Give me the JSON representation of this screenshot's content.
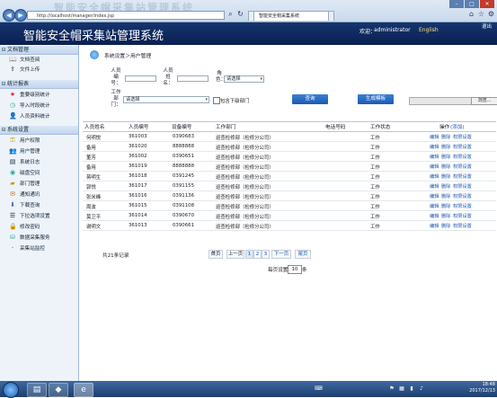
{
  "browser": {
    "address": "http://localhost/manager/index.jsp",
    "tabs": [
      "智能安全帽采集系统"
    ],
    "title_watermark": "智能安全帽采集站管理系统",
    "icons": [
      "back-icon",
      "forward-icon",
      "home-icon",
      "star-icon",
      "gear-icon"
    ]
  },
  "app": {
    "title": "智能安全帽采集站管理系统",
    "welcome": "欢迎：",
    "user": "administrator",
    "language": "English",
    "exit": "退出"
  },
  "sidebar": {
    "sections": [
      {
        "label": "文档管理",
        "items": [
          {
            "label": "文档查阅",
            "icon": "book-icon"
          },
          {
            "label": "文件上传",
            "icon": "upload-icon"
          }
        ]
      },
      {
        "label": "统计报表",
        "items": [
          {
            "label": "重要级别统计",
            "icon": "star-icon"
          },
          {
            "label": "导入时段统计",
            "icon": "clock-icon"
          },
          {
            "label": "人员资料统计",
            "icon": "person-icon"
          }
        ]
      },
      {
        "label": "系统设置",
        "items": [
          {
            "label": "用户权限",
            "icon": "key-icon"
          },
          {
            "label": "用户管理",
            "icon": "users-icon"
          },
          {
            "label": "系统日志",
            "icon": "log-icon"
          },
          {
            "label": "磁盘空间",
            "icon": "disk-icon"
          },
          {
            "label": "部门管理",
            "icon": "folder-icon"
          },
          {
            "label": "通知通讯",
            "icon": "mail-icon"
          },
          {
            "label": "下载查询",
            "icon": "download-icon"
          },
          {
            "label": "下拉选项设置",
            "icon": "list-icon"
          },
          {
            "label": "修改密码",
            "icon": "lock-icon"
          },
          {
            "label": "数据采集服务",
            "icon": "service-icon"
          },
          {
            "label": "采集站监控",
            "icon": "monitor-icon"
          }
        ]
      }
    ]
  },
  "breadcrumb": "系统设置＞用户管理",
  "filters": {
    "person_no_label": "人员编号：",
    "person_name_label": "人员姓名：",
    "role_label": "角色：",
    "role_value": "请选择",
    "dept_label": "工作部门：",
    "dept_value": "请选择",
    "include_sub_label": "包含下级部门",
    "query_button": "查询",
    "export_button": "生成模板",
    "browse_button": "浏览..."
  },
  "table": {
    "headers": [
      "人员姓名",
      "人员编号",
      "设备编号",
      "工作部门",
      "电话号码",
      "工作状态",
      "操作"
    ],
    "add_label": "(添加)",
    "actions": [
      "编辑",
      "删除",
      "权限设置"
    ],
    "rows": [
      {
        "name": "何明悦",
        "no": "361003",
        "device": "0390683",
        "dept": "巡查检修部（检修分公司）",
        "phone": "",
        "status": "工作"
      },
      {
        "name": "备用",
        "no": "361020",
        "device": "8888888",
        "dept": "巡查检修部（检修分公司）",
        "phone": "",
        "status": "工作"
      },
      {
        "name": "董芳",
        "no": "361002",
        "device": "0390651",
        "dept": "巡查检修部（检修分公司）",
        "phone": "",
        "status": "工作"
      },
      {
        "name": "备用",
        "no": "361019",
        "device": "8888888",
        "dept": "巡查检修部（检修分公司）",
        "phone": "",
        "status": "工作"
      },
      {
        "name": "蒋明生",
        "no": "361018",
        "device": "0391245",
        "dept": "巡查检修部（检修分公司）",
        "phone": "",
        "status": "工作"
      },
      {
        "name": "郭悦",
        "no": "361017",
        "device": "0391155",
        "dept": "巡查检修部（检修分公司）",
        "phone": "",
        "status": "工作"
      },
      {
        "name": "张米峰",
        "no": "361016",
        "device": "0391136",
        "dept": "巡查检修部（检修分公司）",
        "phone": "",
        "status": "工作"
      },
      {
        "name": "周波",
        "no": "361015",
        "device": "0391108",
        "dept": "巡查检修部（检修分公司）",
        "phone": "",
        "status": "工作"
      },
      {
        "name": "莫卫平",
        "no": "361014",
        "device": "0390670",
        "dept": "巡查检修部（检修分公司）",
        "phone": "",
        "status": "工作"
      },
      {
        "name": "谢明文",
        "no": "361013",
        "device": "0390661",
        "dept": "巡查检修部（检修分公司）",
        "phone": "",
        "status": "工作"
      }
    ]
  },
  "pagination": {
    "total": "共21条记录",
    "first": "首页",
    "prev": "上一页",
    "pages": [
      "1",
      "2",
      "3"
    ],
    "current": "1",
    "next": "下一页",
    "last": "尾页",
    "per_page_label": "每页设置",
    "per_page_value": "10",
    "per_page_unit": "条"
  },
  "taskbar": {
    "time": "18:48",
    "date": "2017/12/13"
  },
  "colors": {
    "header_bg": "#0a2050",
    "link": "#1a56b5",
    "button": "#1b5bb0",
    "lang": "#ffe07a"
  }
}
